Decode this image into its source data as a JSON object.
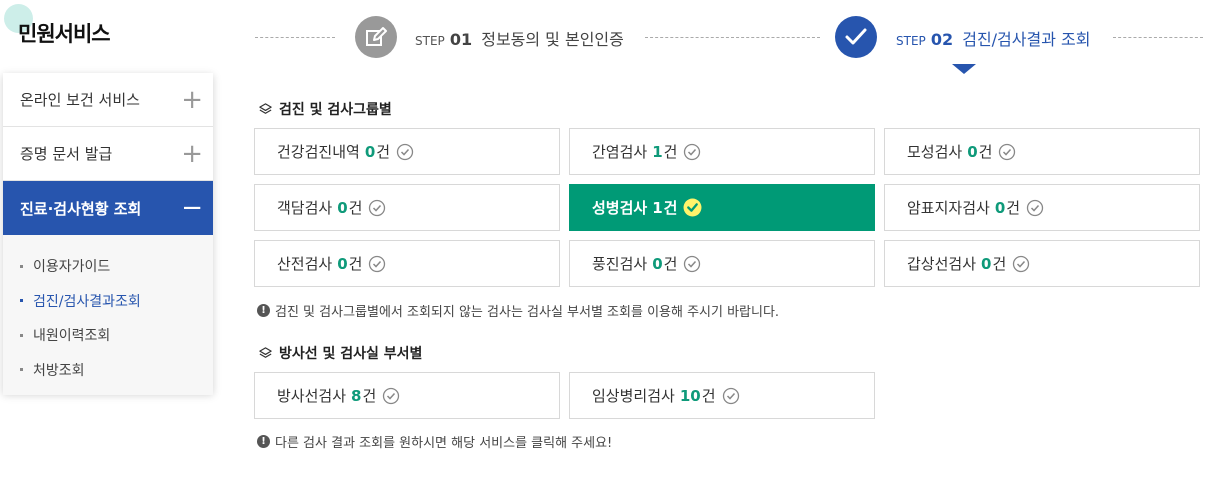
{
  "sidebar": {
    "title": "민원서비스",
    "menu": [
      {
        "label": "온라인 보건 서비스",
        "toggle": "+"
      },
      {
        "label": "증명 문서 발급",
        "toggle": "+"
      },
      {
        "label": "진료·검사현황 조회",
        "toggle": "−"
      }
    ],
    "submenu": [
      {
        "label": "이용자가이드"
      },
      {
        "label": "검진/검사결과조회"
      },
      {
        "label": "내원이력조회"
      },
      {
        "label": "처방조회"
      }
    ]
  },
  "steps": [
    {
      "word": "STEP",
      "num": "01",
      "label": "정보동의 및 본인인증",
      "icon": "edit-icon"
    },
    {
      "word": "STEP",
      "num": "02",
      "label": "검진/검사결과 조회",
      "icon": "check-icon"
    }
  ],
  "section1": {
    "title": "검진 및 검사그룹별",
    "items": [
      {
        "label": "건강검진내역",
        "count": "0",
        "unit": "건"
      },
      {
        "label": "간염검사",
        "count": "1",
        "unit": "건"
      },
      {
        "label": "모성검사",
        "count": "0",
        "unit": "건"
      },
      {
        "label": "객담검사",
        "count": "0",
        "unit": "건"
      },
      {
        "label": "성병검사",
        "count": "1",
        "unit": "건"
      },
      {
        "label": "암표지자검사",
        "count": "0",
        "unit": "건"
      },
      {
        "label": "산전검사",
        "count": "0",
        "unit": "건"
      },
      {
        "label": "풍진검사",
        "count": "0",
        "unit": "건"
      },
      {
        "label": "갑상선검사",
        "count": "0",
        "unit": "건"
      }
    ],
    "notice": "검진 및 검사그룹별에서 조회되지 않는 검사는 검사실 부서별 조회를 이용해 주시기 바랍니다."
  },
  "section2": {
    "title": "방사선 및 검사실 부서별",
    "items": [
      {
        "label": "방사선검사",
        "count": "8",
        "unit": "건"
      },
      {
        "label": "임상병리검사",
        "count": "10",
        "unit": "건"
      }
    ],
    "notice": "다른 검사 결과 조회를 원하시면 해당 서비스를 클릭해 주세요!"
  },
  "colors": {
    "primary_blue": "#2755ae",
    "selected_green": "#009a76",
    "count_green": "#0f9a7a"
  }
}
